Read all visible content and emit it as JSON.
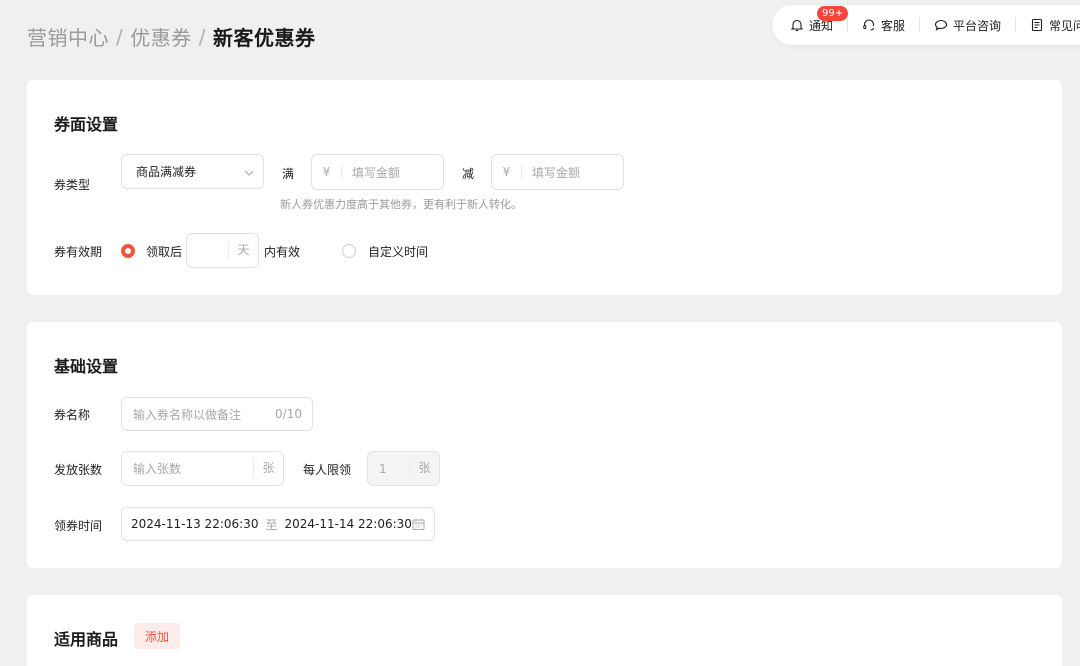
{
  "breadcrumb": {
    "items": [
      "营销中心",
      "优惠券"
    ],
    "separator": "/",
    "current": "新客优惠券"
  },
  "toolbar": {
    "notice_label": "通知",
    "notice_badge": "99+",
    "service_label": "客服",
    "consult_label": "平台咨询",
    "faq_label": "常见问"
  },
  "coupon_face": {
    "title": "券面设置",
    "type_label": "券类型",
    "type_value": "商品满减券",
    "full_label": "满",
    "minus_label": "减",
    "currency": "¥",
    "amount_placeholder": "填写金额",
    "hint": "新人券优惠力度高于其他券，更有利于新人转化。",
    "validity_label": "券有效期",
    "option_after_receive": "领取后",
    "days_unit": "天",
    "valid_within": "内有效",
    "option_custom_time": "自定义时间"
  },
  "basic": {
    "title": "基础设置",
    "name_label": "券名称",
    "name_placeholder": "输入券名称以做备注",
    "name_counter": "0/10",
    "count_label": "发放张数",
    "count_placeholder": "输入张数",
    "count_unit": "张",
    "limit_label": "每人限领",
    "limit_value": "1",
    "limit_unit": "张",
    "time_label": "领券时间",
    "time_start": "2024-11-13 22:06:30",
    "time_to": "至",
    "time_end": "2024-11-14 22:06:30"
  },
  "goods": {
    "title": "适用商品",
    "add_label": "添加"
  },
  "colors": {
    "accent": "#f2553d",
    "badge": "#f5453c",
    "background": "#f0f0f0"
  }
}
